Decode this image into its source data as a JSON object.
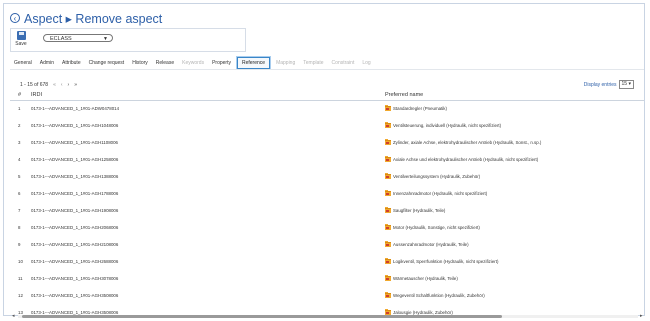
{
  "header": {
    "title": "Aspect ▸ Remove aspect"
  },
  "toolbar": {
    "save_label": "Save",
    "class_select": "ECLASS"
  },
  "tabs": [
    {
      "label": "General",
      "state": "normal"
    },
    {
      "label": "Admin",
      "state": "normal"
    },
    {
      "label": "Attribute",
      "state": "normal"
    },
    {
      "label": "Change request",
      "state": "normal"
    },
    {
      "label": "History",
      "state": "normal"
    },
    {
      "label": "Release",
      "state": "normal"
    },
    {
      "label": "Keywords",
      "state": "disabled"
    },
    {
      "label": "Property",
      "state": "normal"
    },
    {
      "label": "Reference",
      "state": "active"
    },
    {
      "label": "Mapping",
      "state": "disabled"
    },
    {
      "label": "Template",
      "state": "disabled"
    },
    {
      "label": "Constraint",
      "state": "disabled"
    },
    {
      "label": "Log",
      "state": "disabled"
    }
  ],
  "pager": {
    "info": "1 - 15 of 678",
    "first": "«",
    "prev": "‹",
    "next": "›",
    "last": "»"
  },
  "entries": {
    "label": "Display entries",
    "value": "15"
  },
  "table": {
    "headers": {
      "num": "#",
      "irdi": "IRDI",
      "preferred_name": "Preferred name"
    },
    "rows": [
      {
        "num": "1",
        "irdi": "0173-1---ADVANCED_1_1#01-ADW0478014",
        "name": "Standardregler (Pneumatik)"
      },
      {
        "num": "2",
        "irdi": "0173-1---ADVANCED_1_1#01-AGH1048006",
        "name": "Ventilsteuerung, individuell (Hydraulik, nicht spezifiziert)"
      },
      {
        "num": "3",
        "irdi": "0173-1---ADVANCED_1_1#01-AGH1108006",
        "name": "Zylinder, axiale Achse, elektrohydraulischer Antrieb (Hydraulik, Sonst., n.sp.)"
      },
      {
        "num": "4",
        "irdi": "0173-1---ADVANCED_1_1#01-AGH1258006",
        "name": "Axiale Achse und elektrohydraulischer Antrieb (Hydraulik, nicht spezifiziert)"
      },
      {
        "num": "5",
        "irdi": "0173-1---ADVANCED_1_1#01-AGH1388006",
        "name": "Ventilverteilungssystem (Hydraulik, Zubehör)"
      },
      {
        "num": "6",
        "irdi": "0173-1---ADVANCED_1_1#01-AGH1788006",
        "name": "Innenzahnradmotor (Hydraulik, nicht spezifiziert)"
      },
      {
        "num": "7",
        "irdi": "0173-1---ADVANCED_1_1#01-AGH1908006",
        "name": "Saugfilter (Hydraulik, Teile)"
      },
      {
        "num": "8",
        "irdi": "0173-1---ADVANCED_1_1#01-AGH2068006",
        "name": "Motor (Hydraulik, Sonstige, nicht spezifiziert)"
      },
      {
        "num": "9",
        "irdi": "0173-1---ADVANCED_1_1#01-AGH2108006",
        "name": "Aussenzahnradmotor (Hydraulik, Teile)"
      },
      {
        "num": "10",
        "irdi": "0173-1---ADVANCED_1_1#01-AGH2688006",
        "name": "Logikventil, Sperrfunktion (Hydraulik, nicht spezifiziert)"
      },
      {
        "num": "11",
        "irdi": "0173-1---ADVANCED_1_1#01-AGH3078006",
        "name": "Wärmetauscher (Hydraulik, Teile)"
      },
      {
        "num": "12",
        "irdi": "0173-1---ADVANCED_1_1#01-AGH3508006",
        "name": "Wegeventil Schaltfunktion (Hydraulik, Zubehör)"
      },
      {
        "num": "13",
        "irdi": "0173-1---ADVANCED_1_1#01-AGH3508006",
        "name": "Jalousgie (Hydraulik, Zubehör)"
      }
    ]
  }
}
